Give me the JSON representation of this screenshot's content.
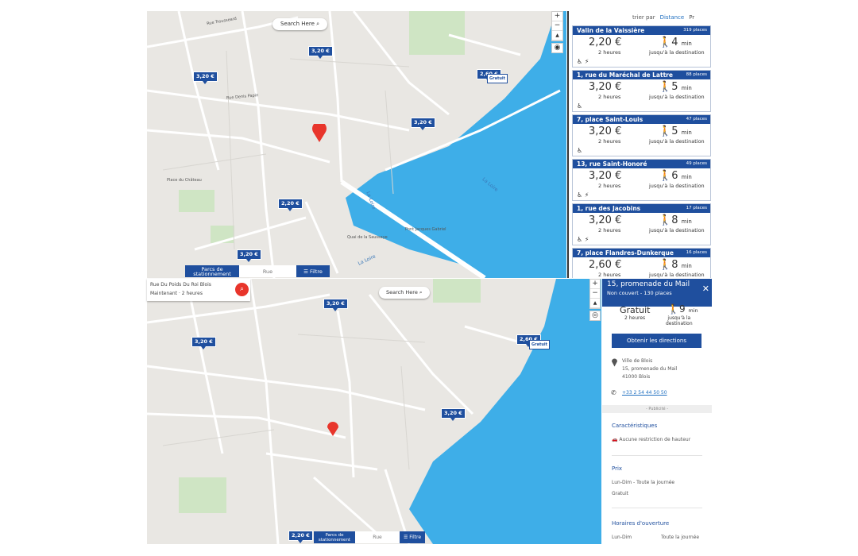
{
  "top": {
    "search_here": "Search Here",
    "list_sort": {
      "label": "trier par",
      "active": "Distance",
      "other": "Pr"
    },
    "price_pins": [
      "3,20 €",
      "3,20 €",
      "3,20 €",
      "2,60 €",
      "2,20 €",
      "3,20 €"
    ],
    "gratuit_pin": "Gratuit",
    "bottom_bar": {
      "parks": "Parcs de stationnement",
      "street": "Rue",
      "filter": "Filtre"
    },
    "map_labels": [
      "Rue Trousseard",
      "La Loire",
      "Le Loire",
      "La Loire",
      "Pont Jacques Gabriel",
      "Quai de la Saussaye",
      "Rue Denis Papin",
      "Place du Château"
    ],
    "cards": [
      {
        "name": "Valin de la Vaissière",
        "places": "319 places",
        "price": "2,20 €",
        "duration": "2 heures",
        "walk": "4",
        "min": "min",
        "dest": "jusqu'à la destination",
        "icons": "♿ ⚡"
      },
      {
        "name": "1, rue du Maréchal de Lattre",
        "places": "88 places",
        "price": "3,20 €",
        "duration": "2 heures",
        "walk": "5",
        "min": "min",
        "dest": "jusqu'à la destination",
        "icons": "♿"
      },
      {
        "name": "7, place Saint-Louis",
        "places": "47 places",
        "price": "3,20 €",
        "duration": "2 heures",
        "walk": "5",
        "min": "min",
        "dest": "jusqu'à la destination",
        "icons": "♿"
      },
      {
        "name": "13, rue Saint-Honoré",
        "places": "49 places",
        "price": "3,20 €",
        "duration": "2 heures",
        "walk": "6",
        "min": "min",
        "dest": "jusqu'à la destination",
        "icons": "♿ ⚡"
      },
      {
        "name": "1, rue des Jacobins",
        "places": "17 places",
        "price": "3,20 €",
        "duration": "2 heures",
        "walk": "8",
        "min": "min",
        "dest": "jusqu'à la destination",
        "icons": "♿ ⚡"
      },
      {
        "name": "7, place Flandres-Dunkerque",
        "places": "16 places",
        "price": "2,60 €",
        "duration": "2 heures",
        "walk": "8",
        "min": "min",
        "dest": "jusqu'à la destination",
        "icons": ""
      }
    ]
  },
  "bottom": {
    "address": "Rue Du Poids Du Roi Blois",
    "when": "Maintenant",
    "duration": "2 heures",
    "search_here": "Search Here",
    "price_pins": [
      "3,20 €",
      "3,20 €",
      "2,60 €",
      "3,20 €",
      "2,20 €"
    ],
    "gratuit_pin": "Gratuit",
    "bottom_bar": {
      "parks": "Parcs de stationnement",
      "street": "Rue",
      "filter": "Filtre"
    },
    "detail": {
      "title": "15, promenade du Mail",
      "subtitle": "Non couvert - 130 places",
      "price": "Gratuit",
      "duration": "2 heures",
      "walk": "9",
      "min": "min",
      "dest_line1": "jusqu'à la",
      "dest_line2": "destination",
      "directions_button": "Obtenir les directions",
      "addr_line1": "Ville de Blois",
      "addr_line2": "15, promenade du Mail",
      "addr_line3": "41000 Blois",
      "phone": "+33 2 54 44 50 50",
      "pub": "- Publicité -",
      "features_title": "Caractéristiques",
      "feature_1": "Aucune restriction de hauteur",
      "price_title": "Prix",
      "price_row_days": "Lun-Dim - Toute la journée",
      "price_row_value": "Gratuit",
      "hours_title": "Horaires d'ouverture",
      "hours_row_days": "Lun-Dim",
      "hours_row_value": "Toute la journée"
    }
  },
  "colors": {
    "brand": "#1f4f9e",
    "water": "#3eaee8",
    "pin_red": "#e8352b"
  }
}
